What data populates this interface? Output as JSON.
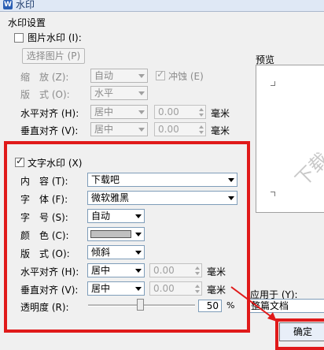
{
  "window": {
    "title": "水印",
    "app_icon": "W"
  },
  "section_title": "水印设置",
  "picture_wm": {
    "checkbox_label": "图片水印 (I):",
    "choose_button": "选择图片 (P)",
    "scale_label": "缩　放 (Z):",
    "scale_value": "自动",
    "washout_label": "冲蚀 (E)",
    "layout_label": "版　式 (O):",
    "layout_value": "水平",
    "halign_label": "水平对齐 (H):",
    "halign_value": "居中",
    "halign_offset": "0.00",
    "valign_label": "垂直对齐 (V):",
    "valign_value": "居中",
    "valign_offset": "0.00",
    "unit": "毫米"
  },
  "preview": {
    "label": "预览",
    "watermark_text": "下载"
  },
  "text_wm": {
    "checkbox_label": "文字水印 (X)",
    "content_label": "内　容 (T):",
    "content_value": "下载吧",
    "font_label": "字　体 (F):",
    "font_value": "微软雅黑",
    "size_label": "字　号 (S):",
    "size_value": "自动",
    "color_label": "颜　色 (C):",
    "color_value": "#c0c0c0",
    "layout_label": "版　式 (O):",
    "layout_value": "倾斜",
    "halign_label": "水平对齐 (H):",
    "halign_value": "居中",
    "halign_offset": "0.00",
    "valign_label": "垂直对齐 (V):",
    "valign_value": "居中",
    "valign_offset": "0.00",
    "unit": "毫米",
    "transparency_label": "透明度 (R):",
    "transparency_value": "50",
    "transparency_unit": "%"
  },
  "apply_to": {
    "label": "应用于 (Y):",
    "value": "整篇文档"
  },
  "buttons": {
    "ok": "确定"
  },
  "colors": {
    "highlight_red": "#e01a1a"
  }
}
